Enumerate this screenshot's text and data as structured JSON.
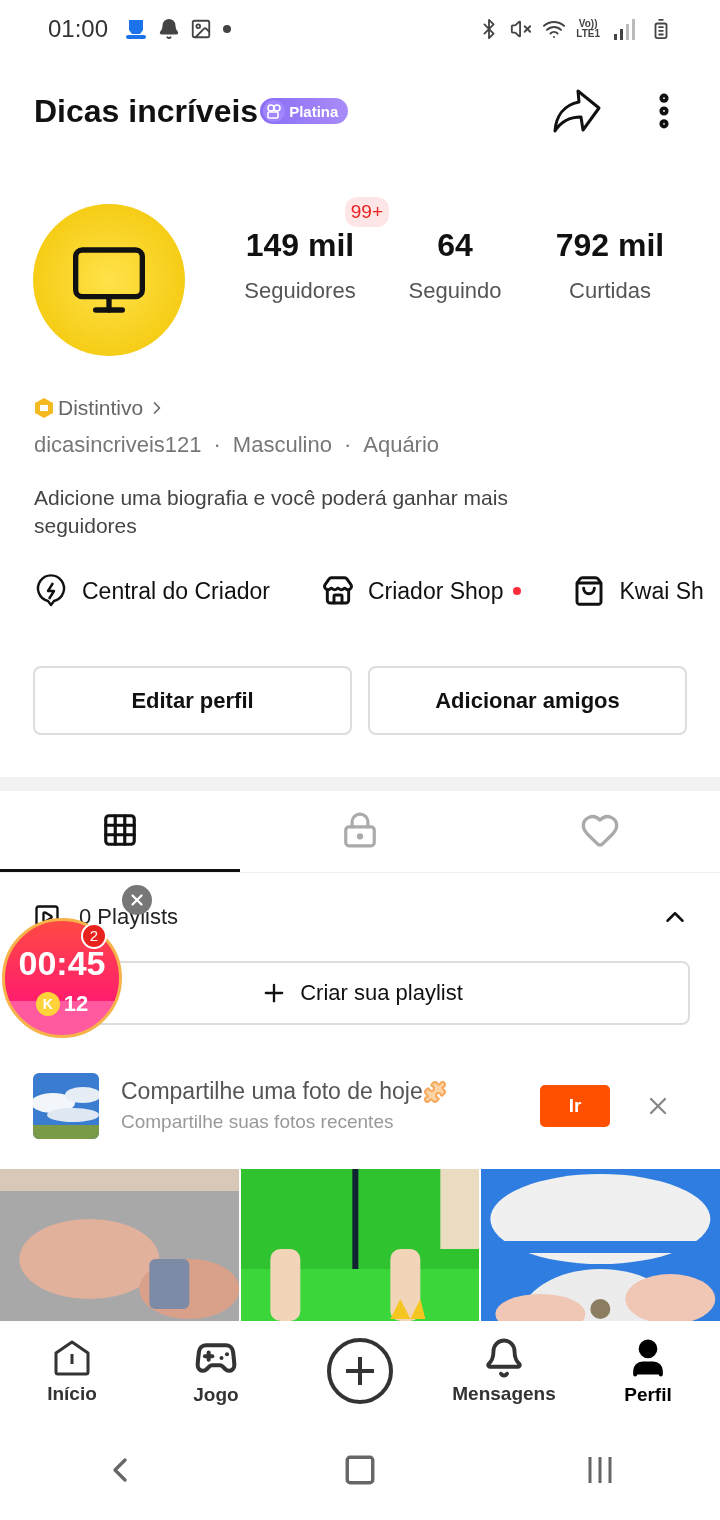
{
  "status_bar": {
    "time": "01:00",
    "volte": "Vo))",
    "network": "LTE1"
  },
  "header": {
    "title": "Dicas incríveis",
    "badge": "Platina"
  },
  "profile": {
    "notification_badge": "99+",
    "stats": [
      {
        "value": "149 mil",
        "label": "Seguidores"
      },
      {
        "value": "64",
        "label": "Seguindo"
      },
      {
        "value": "792 mil",
        "label": "Curtidas"
      }
    ],
    "badge_link": "Distintivo",
    "details": [
      "dicasincriveis121",
      "Masculino",
      "Aquário"
    ],
    "separator": "·",
    "bio": "Adicione uma biografia e você poderá ganhar mais seguidores"
  },
  "shortcuts": [
    {
      "kind": "bolt",
      "label": "Central do Criador",
      "dot": false
    },
    {
      "kind": "shop",
      "label": "Criador Shop",
      "dot": true
    },
    {
      "kind": "bag",
      "label": "Kwai Sh",
      "dot": false
    }
  ],
  "actions": [
    "Editar perfil",
    "Adicionar amigos"
  ],
  "tabs": [
    {
      "kind": "grid",
      "selected": true
    },
    {
      "kind": "lock",
      "selected": false
    },
    {
      "kind": "heart",
      "selected": false
    }
  ],
  "playlists": {
    "label": "0 Playlists",
    "expanded": true,
    "create": "Criar sua playlist"
  },
  "timer": {
    "time": "00:45",
    "badge": "2",
    "coin": "K",
    "coins": "12"
  },
  "suggestion": {
    "title": "Compartilhe uma foto de hoje",
    "subtitle": "Compartilhe suas fotos recentes",
    "button": "Ir"
  },
  "videos": [
    {
      "kind": "picture"
    },
    {
      "kind": "picture"
    },
    {
      "kind": "picture"
    }
  ],
  "nav": [
    {
      "kind": "home",
      "label": "Início",
      "selected": false
    },
    {
      "kind": "game",
      "label": "Jogo",
      "selected": false
    },
    {
      "kind": "create",
      "selected": false
    },
    {
      "kind": "bell",
      "label": "Mensagens",
      "selected": false
    },
    {
      "kind": "user",
      "label": "Perfil",
      "selected": true
    }
  ]
}
